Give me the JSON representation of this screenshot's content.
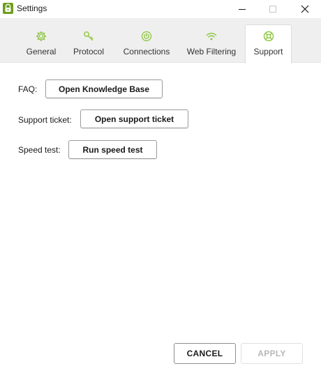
{
  "window": {
    "title": "Settings",
    "icon": "lock-shield-icon",
    "controls": {
      "minimize": "minimize-icon",
      "maximize": "maximize-icon",
      "close": "close-icon"
    }
  },
  "tabs": [
    {
      "label": "General",
      "icon": "gear-icon"
    },
    {
      "label": "Protocol",
      "icon": "key-icon"
    },
    {
      "label": "Connections",
      "icon": "power-icon"
    },
    {
      "label": "Web Filtering",
      "icon": "wifi-icon"
    },
    {
      "label": "Support",
      "icon": "lifebuoy-icon",
      "active": true
    }
  ],
  "support": {
    "faq_label": "FAQ:",
    "faq_button": "Open Knowledge Base",
    "ticket_label": "Support ticket:",
    "ticket_button": "Open support ticket",
    "speed_label": "Speed test:",
    "speed_button": "Run speed test"
  },
  "footer": {
    "cancel": "CANCEL",
    "apply": "APPLY",
    "apply_disabled": true
  },
  "colors": {
    "accent": "#8dc63f",
    "tabstrip_bg": "#efefef",
    "disabled_text": "#b8b8b8"
  }
}
